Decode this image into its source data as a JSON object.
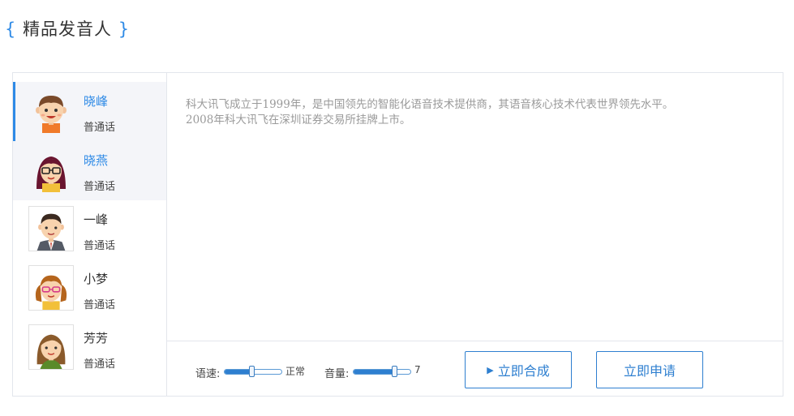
{
  "section_title": {
    "open_brace": "{",
    "text": "精品发音人",
    "close_brace": "}"
  },
  "speakers": [
    {
      "name": "晓峰",
      "lang": "普通话"
    },
    {
      "name": "晓燕",
      "lang": "普通话"
    },
    {
      "name": "一峰",
      "lang": "普通话"
    },
    {
      "name": "小梦",
      "lang": "普通话"
    },
    {
      "name": "芳芳",
      "lang": "普通话"
    }
  ],
  "input_text": "科大讯飞成立于1999年，是中国领先的智能化语音技术提供商，其语音核心技术代表世界领先水平。\n2008年科大讯飞在深圳证券交易所挂牌上市。",
  "controls": {
    "speed_label": "语速:",
    "speed_value": "正常",
    "speed_level": 0.47,
    "volume_label": "音量:",
    "volume_value": "7",
    "volume_level": 0.72,
    "synthesize_label": "立即合成",
    "play_icon": "▶",
    "apply_label": "立即申请"
  },
  "colors": {
    "accent": "#2e8ae6",
    "text_hint": "#9a9a9a"
  }
}
